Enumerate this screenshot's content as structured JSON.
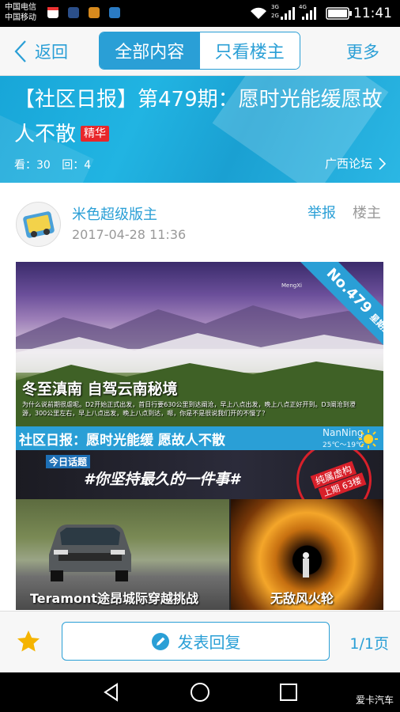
{
  "status_bar": {
    "carrier_1": "中国电信",
    "carrier_2": "中国移动",
    "network_1": "3G",
    "network_2": "2G",
    "network_3": "4G",
    "time": "11:41"
  },
  "nav": {
    "back_label": "返回",
    "tabs": [
      {
        "label": "全部内容",
        "active": true
      },
      {
        "label": "只看楼主",
        "active": false
      }
    ],
    "more_label": "更多"
  },
  "post": {
    "title": "【社区日报】第479期：愿时光能缓愿故人不散",
    "essence_badge": "精华",
    "views": "看：30",
    "replies": "回：4",
    "forum": "广西论坛",
    "author": "米色超级版主",
    "time": "2017-04-28 11:36",
    "report_label": "举报",
    "owner_label": "楼主"
  },
  "image": {
    "headline": "冬至滇南 自驾云南秘境",
    "body": "为什么说前期很虐呢。D2开始正式出发，首日行要630公里到达阐沧，早上八点出发，晚上八点正好开到。D3阐沧到澄源，300公里左右，早上八点出发，晚上八点到达，嗯，你是不是很说我们开的不慢了？",
    "issue_ribbon": "No.479",
    "issue_weekday": "星期五",
    "credit": "MengXi",
    "strip_title": "社区日报：愿时光能缓 愿故人不散",
    "weather_city": "NanNing",
    "weather_temp": "25℃～19℃",
    "topic_tag": "今日话题",
    "topic_text": "#你坚持最久的一件事#",
    "stamp_line1": "纯属虚构",
    "stamp_line2": "上期 63楼",
    "caption_left": "Teramont途昂城际穿越挑战",
    "caption_right": "无敌风火轮"
  },
  "toolbar": {
    "reply_label": "发表回复",
    "page_indicator": "1/1页"
  },
  "watermark": "爱卡汽车",
  "colors": {
    "accent": "#2a9fd6",
    "badge_red": "#e8272b",
    "star": "#f5b400"
  }
}
